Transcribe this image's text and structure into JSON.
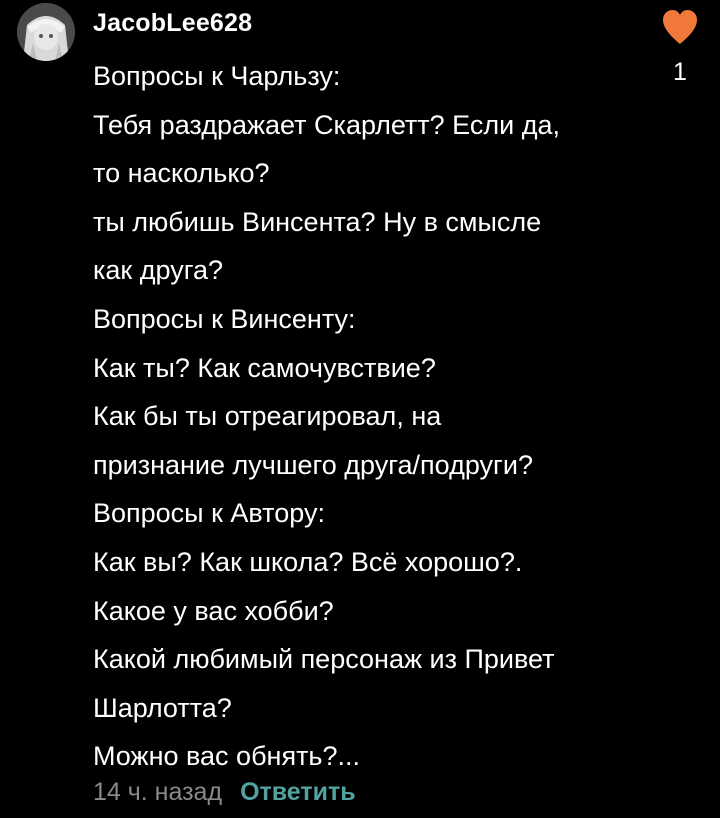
{
  "comment": {
    "username": "JacobLee628",
    "lines": [
      "Вопросы к Чарльзу:",
      "Тебя раздражает Скарлетт? Если да,",
      "то насколько?",
      "ты любишь Винсента? Ну в смысле",
      "как друга?",
      "Вопросы к Винсенту:",
      "Как ты? Как самочувствие?",
      "Как бы ты отреагировал, на",
      "признание лучшего друга/подруги?",
      "Вопросы к Автору:",
      "Как вы? Как школа? Всё хорошо?.",
      "Какое у вас хобби?",
      "Какой любимый персонаж из Привет",
      "Шарлотта?",
      "Можно вас обнять?..."
    ],
    "timestamp": "14 ч. назад",
    "reply_label": "Ответить",
    "like_count": "1",
    "like_icon": "heart-icon",
    "like_color": "#f0793a",
    "reply_color": "#52a3a0"
  }
}
